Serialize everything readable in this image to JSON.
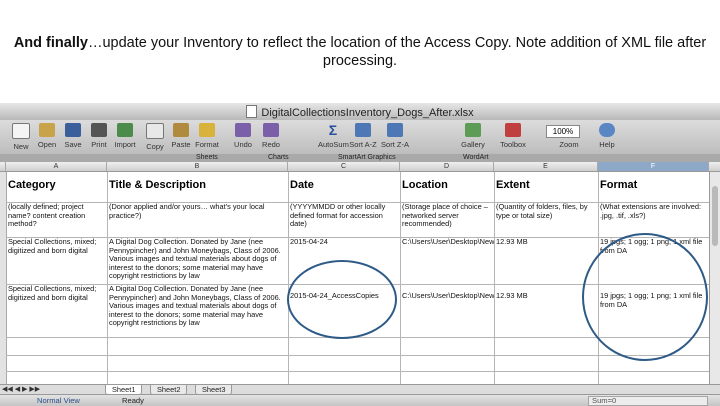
{
  "caption": {
    "bold": "And finally",
    "rest": "…update your Inventory to reflect the location of the Access Copy. Note addition of XML file after processing."
  },
  "window": {
    "title": "DigitalCollectionsInventory_Dogs_After.xlsx"
  },
  "toolbar": {
    "buttons": [
      {
        "label": "New",
        "icon": "new-icon"
      },
      {
        "label": "Open",
        "icon": "open-icon"
      },
      {
        "label": "Save",
        "icon": "save-icon"
      },
      {
        "label": "Print",
        "icon": "print-icon"
      },
      {
        "label": "Import",
        "icon": "import-icon"
      },
      {
        "label": "Copy",
        "icon": "copy-icon"
      },
      {
        "label": "Paste",
        "icon": "paste-icon"
      },
      {
        "label": "Format",
        "icon": "format-icon"
      },
      {
        "label": "Undo",
        "icon": "undo-icon"
      },
      {
        "label": "Redo",
        "icon": "redo-icon"
      },
      {
        "label": "AutoSum",
        "icon": "autosum-icon"
      },
      {
        "label": "Sort A-Z",
        "icon": "sort-az-icon"
      },
      {
        "label": "Sort Z-A",
        "icon": "sort-za-icon"
      },
      {
        "label": "Gallery",
        "icon": "gallery-icon"
      },
      {
        "label": "Toolbox",
        "icon": "toolbox-icon"
      },
      {
        "label": "Zoom",
        "icon": "zoom-icon"
      },
      {
        "label": "Help",
        "icon": "help-icon"
      }
    ],
    "zoom_value": "100%"
  },
  "ribbon": {
    "tabs": [
      "Sheets",
      "Charts",
      "SmartArt Graphics",
      "WordArt"
    ]
  },
  "columns": [
    "A",
    "B",
    "C",
    "D",
    "E",
    "F"
  ],
  "headers": [
    "Category",
    "Title & Description",
    "Date",
    "Location",
    "Extent",
    "Format"
  ],
  "rows": [
    {
      "category": "(locally defined; project name? content creation method?",
      "title": "(Donor applied and/or yours… what's your local practice?)",
      "date": "(YYYYMMDD or other locally defined format for accession date)",
      "location": "(Storage place of choice – networked server recommended)",
      "extent": "(Quantity of folders, files, by type or total size)",
      "format": "(What extensions are involved: .jpg, .tif, .xls?)"
    },
    {
      "category": "Special Collections, mixed; digitized and born digital",
      "title": "A Digital Dog Collection. Donated by Jane (nee Pennypincher) and John Moneybags, Class of 2006. Various images and textual materials about dogs of interest to the donors; some material may have copyright restrictions by law",
      "date": "2015-04-24",
      "location": "C:\\Users\\User\\Desktop\\NewAccession\\Masters",
      "extent": "12.93 MB",
      "format": "19 jpgs; 1 ogg; 1 png; 1 xml file from DA"
    },
    {
      "category": "Special Collections, mixed; digitized and born digital",
      "title": "A Digital Dog Collection. Donated by Jane (nee Pennypincher) and John Moneybags, Class of 2006. Various images and textual materials about dogs of interest to the donors; some material may have copyright restrictions by law",
      "date": "2015-04-24_AccessCopies",
      "location": "C:\\Users\\User\\Desktop\\NewAccession\\AccessCopies",
      "extent": "12.93 MB",
      "format": "19 jpgs; 1 ogg; 1 png; 1 xml file from DA"
    }
  ],
  "sheets": [
    "Sheet1",
    "Sheet2",
    "Sheet3"
  ],
  "status": {
    "view": "Normal View",
    "state": "Ready",
    "sum": "Sum=0"
  },
  "colors": {
    "annotation_circle": "#2d5a86",
    "selected_column": "#8ea9c8"
  }
}
